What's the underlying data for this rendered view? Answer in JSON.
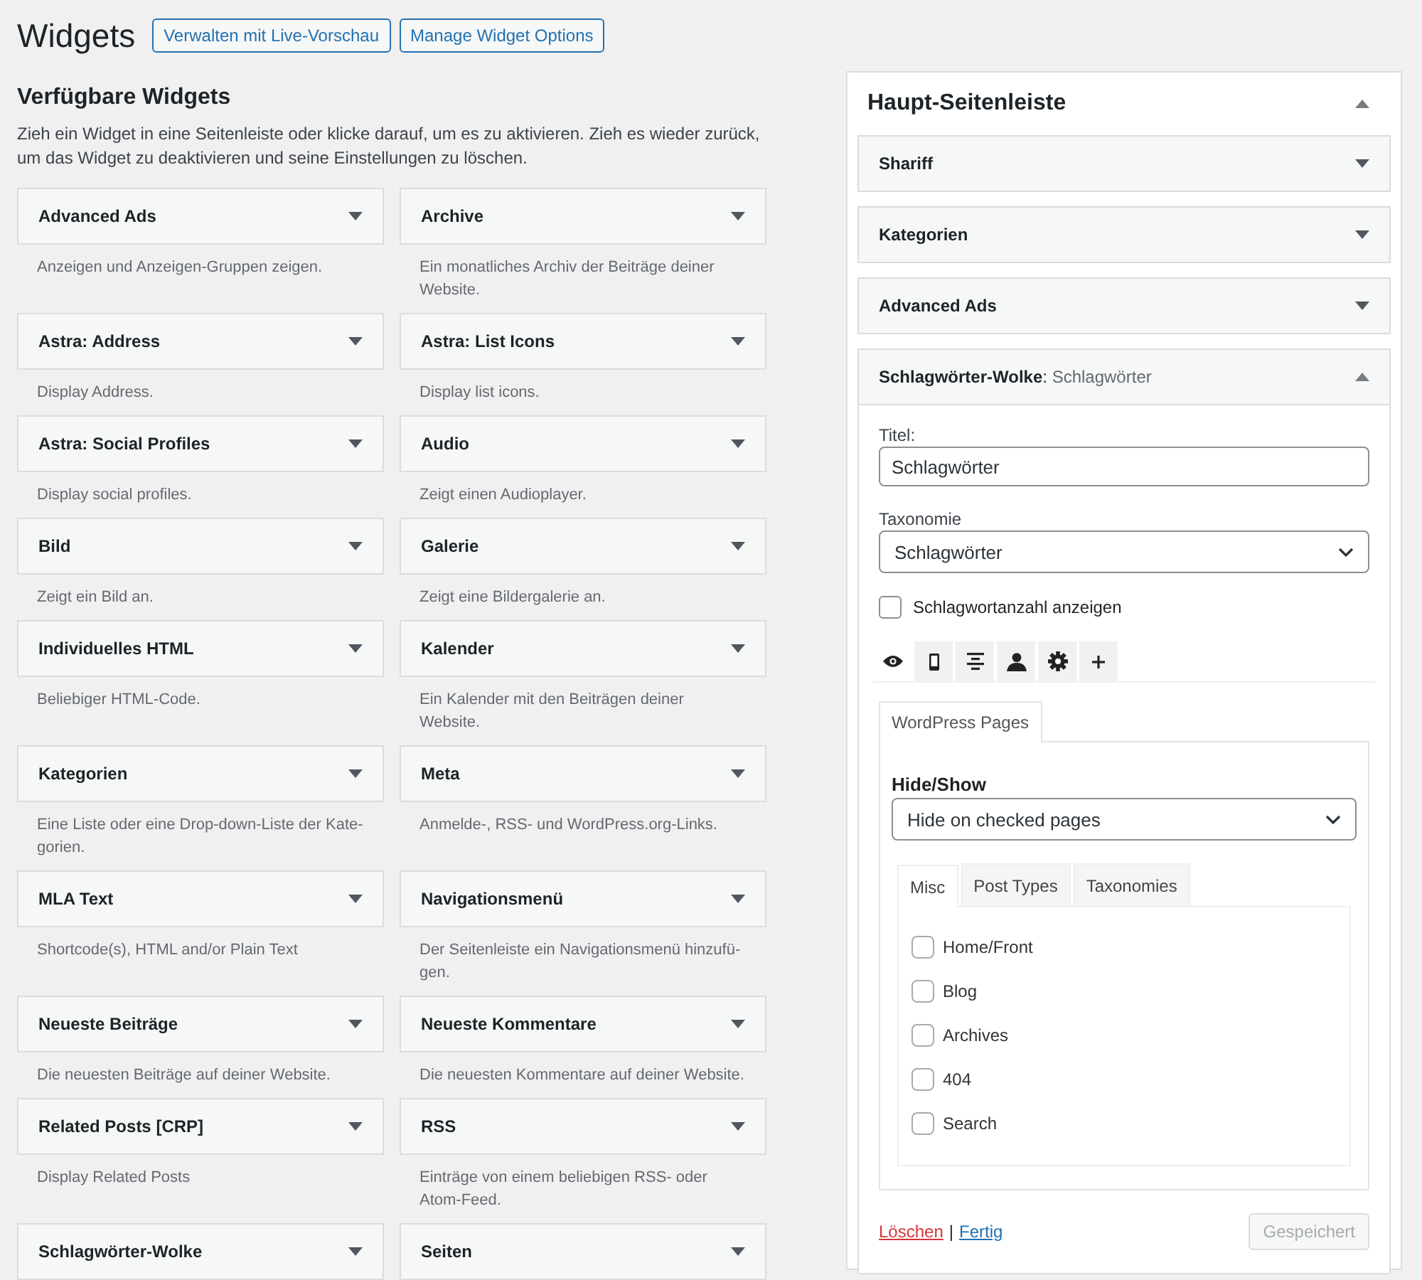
{
  "page": {
    "title": "Widgets",
    "buttons": [
      "Verwalten mit Live-Vorschau",
      "Manage Widget Options"
    ]
  },
  "available": {
    "heading": "Verfügbare Widgets",
    "intro": "Zieh ein Widget in eine Seitenleiste oder klicke darauf, um es zu aktivieren. Zieh es wieder zurück, um das Widget zu deaktivieren und seine Einstellungen zu löschen.",
    "widgets": [
      {
        "name": "Advanced Ads",
        "description": "Anzeigen und Anzeigen-Gruppen zeigen."
      },
      {
        "name": "Archive",
        "description": "Ein monatliches Archiv der Beiträge deiner Website."
      },
      {
        "name": "Astra: Address",
        "description": "Display Address."
      },
      {
        "name": "Astra: List Icons",
        "description": "Display list icons."
      },
      {
        "name": "Astra: Social Profiles",
        "description": "Display social profiles."
      },
      {
        "name": "Audio",
        "description": "Zeigt einen Audioplayer."
      },
      {
        "name": "Bild",
        "description": "Zeigt ein Bild an."
      },
      {
        "name": "Galerie",
        "description": "Zeigt eine Bildergalerie an."
      },
      {
        "name": "Individuelles HTML",
        "description": "Beliebiger HTML-Code."
      },
      {
        "name": "Kalender",
        "description": "Ein Kalender mit den Beiträgen deiner Website."
      },
      {
        "name": "Kategorien",
        "description": "Eine Liste oder eine Drop-down-Liste der Kate-gorien."
      },
      {
        "name": "Meta",
        "description": "Anmelde-, RSS- und WordPress.org-Links."
      },
      {
        "name": "MLA Text",
        "description": "Shortcode(s), HTML and/or Plain Text"
      },
      {
        "name": "Navigationsmenü",
        "description": "Der Seitenleiste ein Navigationsmenü hinzufü-gen."
      },
      {
        "name": "Neueste Beiträge",
        "description": "Die neuesten Beiträge auf deiner Website."
      },
      {
        "name": "Neueste Kommentare",
        "description": "Die neuesten Kommentare auf deiner Website."
      },
      {
        "name": "Related Posts [CRP]",
        "description": "Display Related Posts"
      },
      {
        "name": "RSS",
        "description": "Einträge von einem beliebigen RSS- oder Atom-Feed."
      },
      {
        "name": "Schlagwörter-Wolke"
      },
      {
        "name": "Seiten"
      }
    ]
  },
  "sidebar": {
    "title": "Haupt-Seitenleiste",
    "expanded": true,
    "widgets": [
      {
        "name": "Shariff",
        "expanded": false
      },
      {
        "name": "Kategorien",
        "expanded": false
      },
      {
        "name": "Advanced Ads",
        "expanded": false
      },
      {
        "name": "Schlagwörter-Wolke",
        "separator": ":",
        "subtitle": "Schlagwörter",
        "expanded": true
      }
    ],
    "form": {
      "title_label": "Titel:",
      "title_value": "Schlagwörter",
      "taxonomy_label": "Taxonomie",
      "taxonomy_value": "Schlagwörter",
      "count_label": "Schlagwortanzahl anzeigen",
      "count_checked": false,
      "icon_tabs": [
        {
          "kind": "eye",
          "selected": true
        },
        {
          "kind": "mobile",
          "selected": false
        },
        {
          "kind": "align",
          "selected": false
        },
        {
          "kind": "user",
          "selected": false
        },
        {
          "kind": "gear",
          "selected": false
        },
        {
          "kind": "plus",
          "selected": false
        }
      ],
      "page_tabs": [
        {
          "label": "WordPress Pages",
          "selected": true
        }
      ],
      "hide_show_label": "Hide/Show",
      "hide_show_value": "Hide on checked pages",
      "sub_tabs": [
        {
          "label": "Misc",
          "selected": true
        },
        {
          "label": "Post Types",
          "selected": false
        },
        {
          "label": "Taxonomies",
          "selected": false
        }
      ],
      "pages": [
        {
          "label": "Home/Front",
          "checked": false
        },
        {
          "label": "Blog",
          "checked": false
        },
        {
          "label": "Archives",
          "checked": false
        },
        {
          "label": "404",
          "checked": false
        },
        {
          "label": "Search",
          "checked": false
        }
      ],
      "delete_link": "Löschen",
      "separator": "|",
      "done_link": "Fertig",
      "save_button": "Gespeichert",
      "save_disabled": true
    }
  }
}
